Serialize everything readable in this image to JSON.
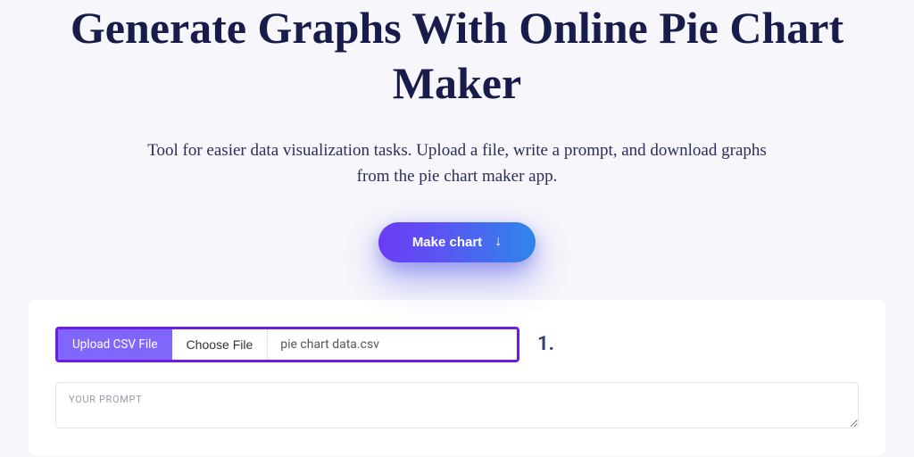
{
  "hero": {
    "title": "Generate Graphs With Online Pie Chart Maker",
    "subtitle": "Tool for easier data visualization tasks. Upload a file, write a prompt, and download graphs from the pie chart maker app.",
    "cta_label": "Make chart"
  },
  "form": {
    "upload_label": "Upload CSV File",
    "choose_file_label": "Choose File",
    "file_name": "pie chart data.csv",
    "step_number": "1.",
    "prompt_placeholder": "YOUR PROMPT"
  }
}
